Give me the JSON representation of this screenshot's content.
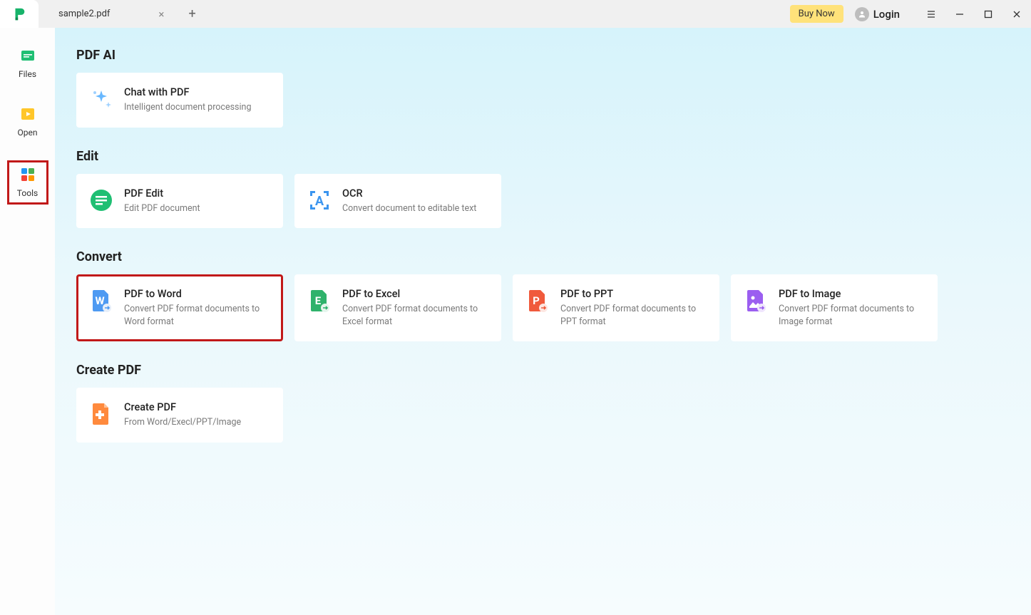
{
  "titlebar": {
    "tab_name": "sample2.pdf",
    "buy_now": "Buy Now",
    "login": "Login"
  },
  "sidebar": {
    "items": [
      {
        "label": "Files"
      },
      {
        "label": "Open"
      },
      {
        "label": "Tools"
      }
    ]
  },
  "sections": {
    "pdf_ai": {
      "title": "PDF AI",
      "chat": {
        "title": "Chat with PDF",
        "desc": "Intelligent document processing"
      }
    },
    "edit": {
      "title": "Edit",
      "pdf_edit": {
        "title": "PDF Edit",
        "desc": "Edit PDF document"
      },
      "ocr": {
        "title": "OCR",
        "desc": "Convert document to editable text"
      }
    },
    "convert": {
      "title": "Convert",
      "to_word": {
        "title": "PDF to Word",
        "desc": "Convert PDF format documents to Word format"
      },
      "to_excel": {
        "title": "PDF to Excel",
        "desc": "Convert PDF format documents to Excel format"
      },
      "to_ppt": {
        "title": "PDF to PPT",
        "desc": "Convert PDF format documents to PPT format"
      },
      "to_image": {
        "title": "PDF to Image",
        "desc": "Convert PDF format documents to Image format"
      }
    },
    "create": {
      "title": "Create PDF",
      "create_pdf": {
        "title": "Create PDF",
        "desc": "From Word/Execl/PPT/Image"
      }
    }
  }
}
